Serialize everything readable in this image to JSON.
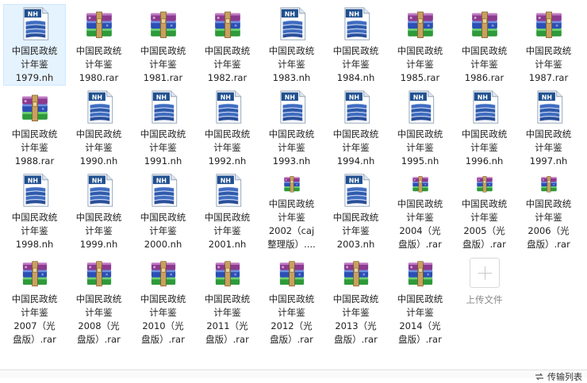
{
  "files": [
    {
      "line1": "中国民政统",
      "line2": "计年鉴",
      "line3": "1979.nh",
      "line4": "",
      "type": "nh",
      "selected": true
    },
    {
      "line1": "中国民政统",
      "line2": "计年鉴",
      "line3": "1980.rar",
      "line4": "",
      "type": "rar"
    },
    {
      "line1": "中国民政统",
      "line2": "计年鉴",
      "line3": "1981.rar",
      "line4": "",
      "type": "rar"
    },
    {
      "line1": "中国民政统",
      "line2": "计年鉴",
      "line3": "1982.rar",
      "line4": "",
      "type": "rar"
    },
    {
      "line1": "中国民政统",
      "line2": "计年鉴",
      "line3": "1983.nh",
      "line4": "",
      "type": "nh"
    },
    {
      "line1": "中国民政统",
      "line2": "计年鉴",
      "line3": "1984.nh",
      "line4": "",
      "type": "nh"
    },
    {
      "line1": "中国民政统",
      "line2": "计年鉴",
      "line3": "1985.rar",
      "line4": "",
      "type": "rar"
    },
    {
      "line1": "中国民政统",
      "line2": "计年鉴",
      "line3": "1986.rar",
      "line4": "",
      "type": "rar"
    },
    {
      "line1": "中国民政统",
      "line2": "计年鉴",
      "line3": "1987.rar",
      "line4": "",
      "type": "rar"
    },
    {
      "line1": "中国民政统",
      "line2": "计年鉴",
      "line3": "1988.rar",
      "line4": "",
      "type": "rar"
    },
    {
      "line1": "中国民政统",
      "line2": "计年鉴",
      "line3": "1990.nh",
      "line4": "",
      "type": "nh"
    },
    {
      "line1": "中国民政统",
      "line2": "计年鉴",
      "line3": "1991.nh",
      "line4": "",
      "type": "nh"
    },
    {
      "line1": "中国民政统",
      "line2": "计年鉴",
      "line3": "1992.nh",
      "line4": "",
      "type": "nh"
    },
    {
      "line1": "中国民政统",
      "line2": "计年鉴",
      "line3": "1993.nh",
      "line4": "",
      "type": "nh"
    },
    {
      "line1": "中国民政统",
      "line2": "计年鉴",
      "line3": "1994.nh",
      "line4": "",
      "type": "nh"
    },
    {
      "line1": "中国民政统",
      "line2": "计年鉴",
      "line3": "1995.nh",
      "line4": "",
      "type": "nh"
    },
    {
      "line1": "中国民政统",
      "line2": "计年鉴",
      "line3": "1996.nh",
      "line4": "",
      "type": "nh"
    },
    {
      "line1": "中国民政统",
      "line2": "计年鉴",
      "line3": "1997.nh",
      "line4": "",
      "type": "nh"
    },
    {
      "line1": "中国民政统",
      "line2": "计年鉴",
      "line3": "1998.nh",
      "line4": "",
      "type": "nh"
    },
    {
      "line1": "中国民政统",
      "line2": "计年鉴",
      "line3": "1999.nh",
      "line4": "",
      "type": "nh"
    },
    {
      "line1": "中国民政统",
      "line2": "计年鉴",
      "line3": "2000.nh",
      "line4": "",
      "type": "nh"
    },
    {
      "line1": "中国民政统",
      "line2": "计年鉴",
      "line3": "2001.nh",
      "line4": "",
      "type": "nh"
    },
    {
      "line1": "中国民政统",
      "line2": "计年鉴",
      "line3": "2002（caj",
      "line4": "整理版）....",
      "type": "rar"
    },
    {
      "line1": "中国民政统",
      "line2": "计年鉴",
      "line3": "2003.nh",
      "line4": "",
      "type": "nh"
    },
    {
      "line1": "中国民政统",
      "line2": "计年鉴",
      "line3": "2004（光",
      "line4": "盘版）.rar",
      "type": "rar"
    },
    {
      "line1": "中国民政统",
      "line2": "计年鉴",
      "line3": "2005（光",
      "line4": "盘版）.rar",
      "type": "rar"
    },
    {
      "line1": "中国民政统",
      "line2": "计年鉴",
      "line3": "2006（光",
      "line4": "盘版）.rar",
      "type": "rar"
    },
    {
      "line1": "中国民政统",
      "line2": "计年鉴",
      "line3": "2007（光",
      "line4": "盘版）.rar",
      "type": "rar"
    },
    {
      "line1": "中国民政统",
      "line2": "计年鉴",
      "line3": "2008（光",
      "line4": "盘版）.rar",
      "type": "rar"
    },
    {
      "line1": "中国民政统",
      "line2": "计年鉴",
      "line3": "2010（光",
      "line4": "盘版）.rar",
      "type": "rar"
    },
    {
      "line1": "中国民政统",
      "line2": "计年鉴",
      "line3": "2011（光",
      "line4": "盘版）.rar",
      "type": "rar"
    },
    {
      "line1": "中国民政统",
      "line2": "计年鉴",
      "line3": "2012（光",
      "line4": "盘版）.rar",
      "type": "rar"
    },
    {
      "line1": "中国民政统",
      "line2": "计年鉴",
      "line3": "2013（光",
      "line4": "盘版）.rar",
      "type": "rar"
    },
    {
      "line1": "中国民政统",
      "line2": "计年鉴",
      "line3": "2014（光",
      "line4": "盘版）.rar",
      "type": "rar"
    }
  ],
  "upload": {
    "label": "上传文件"
  },
  "status": {
    "transfer_label": "传输列表"
  },
  "icons": {
    "nh": "nh-document-icon",
    "rar": "rar-archive-icon",
    "upload": "plus-icon"
  },
  "colors": {
    "selected_bg": "#e5f3ff",
    "nh_badge": "#1f4f8f",
    "rar_purple": "#8b3a8f",
    "rar_green": "#2e9a3a",
    "rar_blue": "#2a4fb5"
  }
}
